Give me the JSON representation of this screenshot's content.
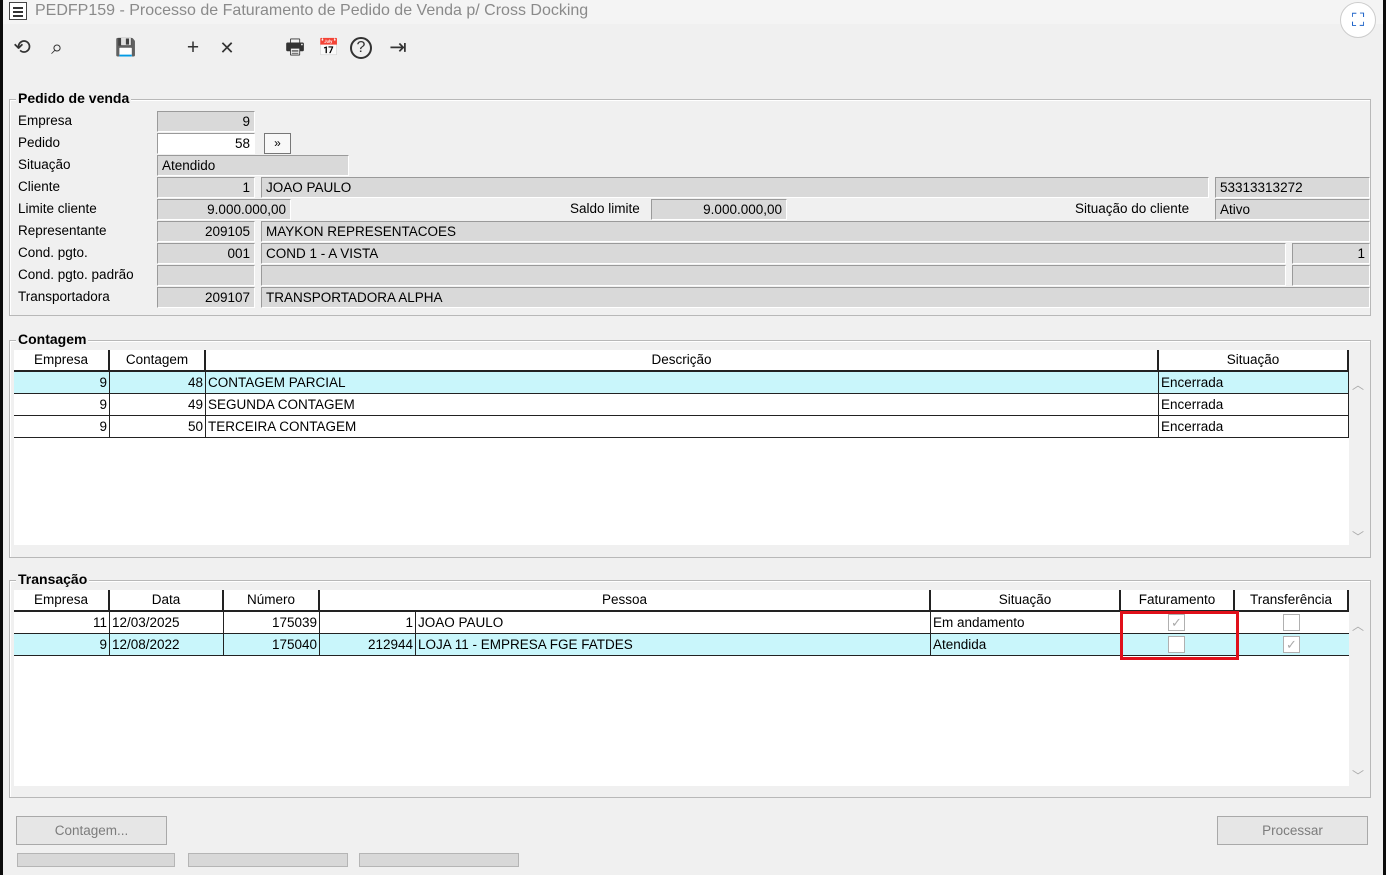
{
  "window": {
    "title": "PEDFP159 - Processo de Faturamento de Pedido de Venda p/ Cross Docking"
  },
  "toolbar": {
    "icons": [
      "undo-icon",
      "search-icon",
      "save-icon",
      "add-icon",
      "delete-icon",
      "print-icon",
      "calendar-icon",
      "help-icon",
      "exit-icon"
    ],
    "glyphs": {
      "undo": "⟲",
      "search": "⌕",
      "save": "💾",
      "add": "+",
      "delete": "✕",
      "print": "🖶",
      "calendar": "📅",
      "help": "?",
      "exit": "⇥"
    }
  },
  "pedido": {
    "legend": "Pedido de venda",
    "labels": {
      "empresa": "Empresa",
      "pedido": "Pedido",
      "situacao": "Situação",
      "cliente": "Cliente",
      "limite": "Limite cliente",
      "representante": "Representante",
      "cond": "Cond. pgto.",
      "cond_padrao": "Cond. pgto. padrão",
      "transportadora": "Transportadora",
      "saldo": "Saldo limite",
      "situacao_cliente": "Situação do cliente"
    },
    "values": {
      "empresa": "9",
      "pedido": "58",
      "situacao": "Atendido",
      "cliente_cod": "1",
      "cliente_nome": "JOAO PAULO",
      "cliente_doc": "53313313272",
      "limite": "9.000.000,00",
      "saldo": "9.000.000,00",
      "situacao_cliente": "Ativo",
      "rep_cod": "209105",
      "rep_nome": "MAYKON REPRESENTACOES",
      "cond_cod": "001",
      "cond_nome": "COND 1 - A VISTA",
      "cond_num": "1",
      "cond_padrao_cod": "",
      "cond_padrao_nome": "",
      "transp_cod": "209107",
      "transp_nome": "TRANSPORTADORA ALPHA"
    },
    "nav_button": "»"
  },
  "contagem": {
    "legend": "Contagem",
    "columns": [
      "Empresa",
      "Contagem",
      "Descrição",
      "Situação"
    ],
    "rows": [
      {
        "empresa": "9",
        "contagem": "48",
        "descricao": "CONTAGEM PARCIAL",
        "situacao": "Encerrada"
      },
      {
        "empresa": "9",
        "contagem": "49",
        "descricao": "SEGUNDA CONTAGEM",
        "situacao": "Encerrada"
      },
      {
        "empresa": "9",
        "contagem": "50",
        "descricao": "TERCEIRA CONTAGEM",
        "situacao": "Encerrada"
      }
    ]
  },
  "transacao": {
    "legend": "Transação",
    "columns": [
      "Empresa",
      "Data",
      "Número",
      "Pessoa",
      "Situação",
      "Faturamento",
      "Transferência"
    ],
    "rows": [
      {
        "empresa": "11",
        "data": "12/03/2025",
        "numero": "175039",
        "pessoa_cod": "1",
        "pessoa_nome": "JOAO PAULO",
        "situacao": "Em andamento",
        "faturamento": true,
        "transferencia": false
      },
      {
        "empresa": "9",
        "data": "12/08/2022",
        "numero": "175040",
        "pessoa_cod": "212944",
        "pessoa_nome": "LOJA 11 - EMPRESA FGE FATDES",
        "situacao": "Atendida",
        "faturamento": false,
        "transferencia": true
      }
    ],
    "highlight_color": "#e0101a"
  },
  "buttons": {
    "contagem": "Contagem...",
    "processar": "Processar"
  },
  "colors": {
    "selected_row": "#c9f6fb"
  }
}
